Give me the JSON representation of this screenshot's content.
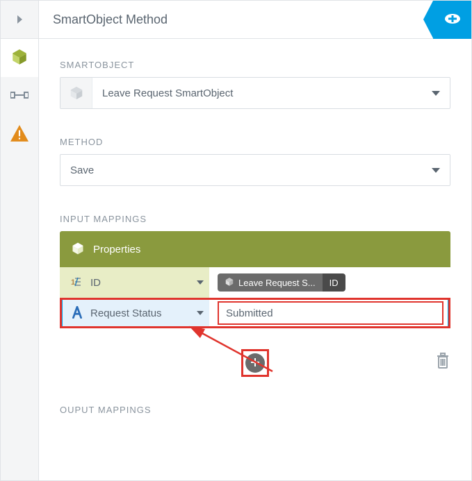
{
  "title": "SmartObject Method",
  "sections": {
    "smartobject": {
      "label": "SMARTOBJECT",
      "value": "Leave Request SmartObject"
    },
    "method": {
      "label": "METHOD",
      "value": "Save"
    },
    "input_mappings": {
      "label": "INPUT MAPPINGS",
      "header": "Properties",
      "rows": {
        "id": {
          "name": "ID",
          "chip_main": "Leave Request S...",
          "chip_tail": "ID"
        },
        "status": {
          "name": "Request Status",
          "value": "Submitted"
        }
      }
    },
    "output_mappings": {
      "label": "OUPUT MAPPINGS"
    }
  }
}
